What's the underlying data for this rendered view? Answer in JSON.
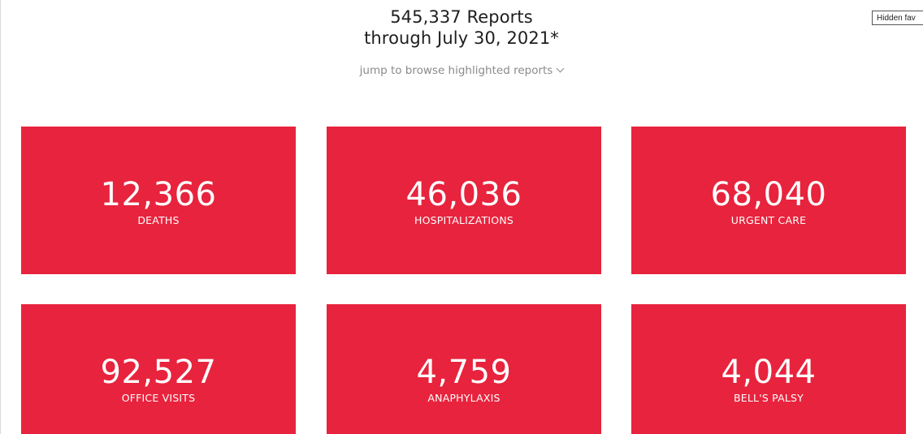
{
  "header": {
    "title_line1": "545,337 Reports",
    "title_line2": "through July 30, 2021*",
    "jump_label": "jump to browse highlighted reports"
  },
  "hidden_button": {
    "label": "Hidden fav"
  },
  "cards": [
    {
      "value": "12,366",
      "label": "DEATHS"
    },
    {
      "value": "46,036",
      "label": "HOSPITALIZATIONS"
    },
    {
      "value": "68,040",
      "label": "URGENT CARE"
    },
    {
      "value": "92,527",
      "label": "OFFICE VISITS"
    },
    {
      "value": "4,759",
      "label": "ANAPHYLAXIS"
    },
    {
      "value": "4,044",
      "label": "BELL'S PALSY"
    }
  ],
  "icons": {
    "jump_chevron": "chevron-down-icon"
  },
  "colors": {
    "card_background": "#e8233d",
    "card_text": "#ffffff",
    "title_text": "#1e1e1e",
    "jump_text": "#8a8a8a"
  }
}
